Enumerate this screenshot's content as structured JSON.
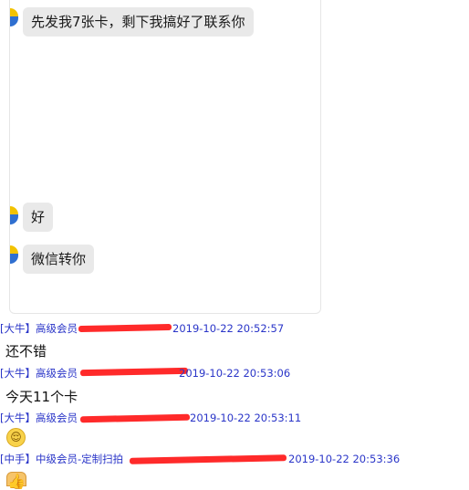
{
  "panel": {
    "messages": [
      {
        "text": "先发我7张卡，剩下我搞好了联系你"
      },
      {
        "text": "好"
      },
      {
        "text": "微信转你"
      }
    ]
  },
  "feed": [
    {
      "sender": "[大牛】高级会员",
      "time": "2019-10-22 20:52:57",
      "text": "还不错"
    },
    {
      "sender": "[大牛】高级会员",
      "time": "2019-10-22 20:53:06",
      "text": "今天11个卡"
    },
    {
      "sender": "[大牛】高级会员",
      "time": "2019-10-22 20:53:11",
      "emoji": "😌"
    },
    {
      "sender": "[中手】中级会员-定制扫拍",
      "time": "2019-10-22 20:53:36",
      "emoji": "👍"
    }
  ]
}
